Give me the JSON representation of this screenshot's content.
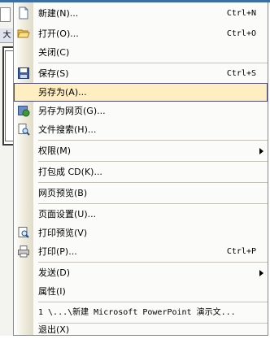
{
  "background": {
    "pane_tab_label": "大"
  },
  "menu": {
    "items": [
      {
        "label": "新建(N)...",
        "shortcut": "Ctrl+N",
        "icon": "new-document-icon"
      },
      {
        "label": "打开(O)...",
        "shortcut": "Ctrl+O",
        "icon": "open-folder-icon"
      },
      {
        "label": "关闭(C)",
        "shortcut": ""
      },
      {
        "label": "保存(S)",
        "shortcut": "Ctrl+S",
        "icon": "save-disk-icon"
      },
      {
        "label": "另存为(A)...",
        "shortcut": "",
        "highlighted": true
      },
      {
        "label": "另存为网页(G)...",
        "shortcut": "",
        "icon": "save-as-web-icon"
      },
      {
        "label": "文件搜索(H)...",
        "shortcut": "",
        "icon": "file-search-icon"
      },
      {
        "label": "权限(M)",
        "shortcut": "",
        "submenu": true
      },
      {
        "label": "打包成 CD(K)...",
        "shortcut": ""
      },
      {
        "label": "网页预览(B)",
        "shortcut": ""
      },
      {
        "label": "页面设置(U)...",
        "shortcut": ""
      },
      {
        "label": "打印预览(V)",
        "shortcut": "",
        "icon": "print-preview-icon"
      },
      {
        "label": "打印(P)...",
        "shortcut": "Ctrl+P",
        "icon": "printer-icon"
      },
      {
        "label": "发送(D)",
        "shortcut": "",
        "submenu": true
      },
      {
        "label": "属性(I)",
        "shortcut": ""
      },
      {
        "label": "1 \\...\\新建 Microsoft PowerPoint 演示文...",
        "shortcut": ""
      },
      {
        "label": "退出(X)",
        "shortcut": ""
      }
    ],
    "highlight_color": "#ffeec2"
  }
}
